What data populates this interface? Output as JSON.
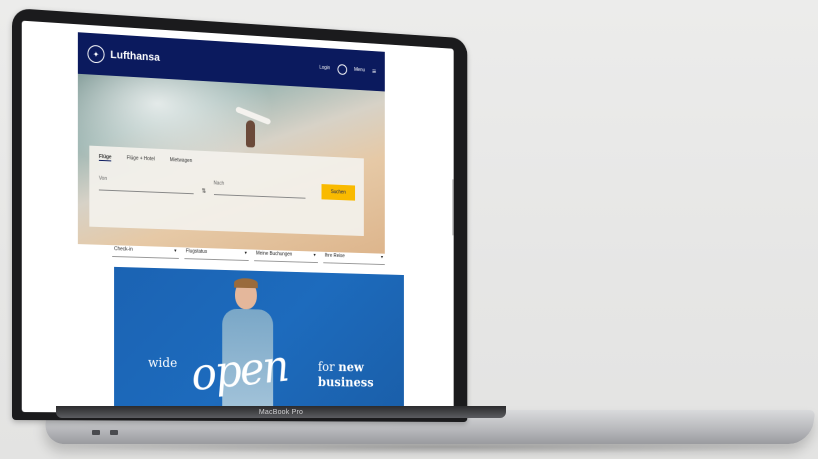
{
  "device": {
    "model_label": "MacBook Pro"
  },
  "site": {
    "brand": "Lufthansa",
    "topbar": {
      "login_label": "Login",
      "menu_label": "Menu"
    },
    "booking": {
      "tabs": [
        "Flüge",
        "Flüge + Hotel",
        "Mietwagen"
      ],
      "from_label": "Von",
      "to_label": "Nach",
      "search_label": "Suchen"
    },
    "quick_links": [
      "Check-in",
      "Flugstatus",
      "Meine Buchungen",
      "Ihre Reise"
    ],
    "promo": {
      "wide": "wide",
      "open": "open",
      "for": "for",
      "new": "new",
      "business": "business"
    }
  },
  "colors": {
    "navy": "#0b1a5e",
    "yellow": "#f9ba00",
    "promo_blue": "#1d6bbd"
  }
}
